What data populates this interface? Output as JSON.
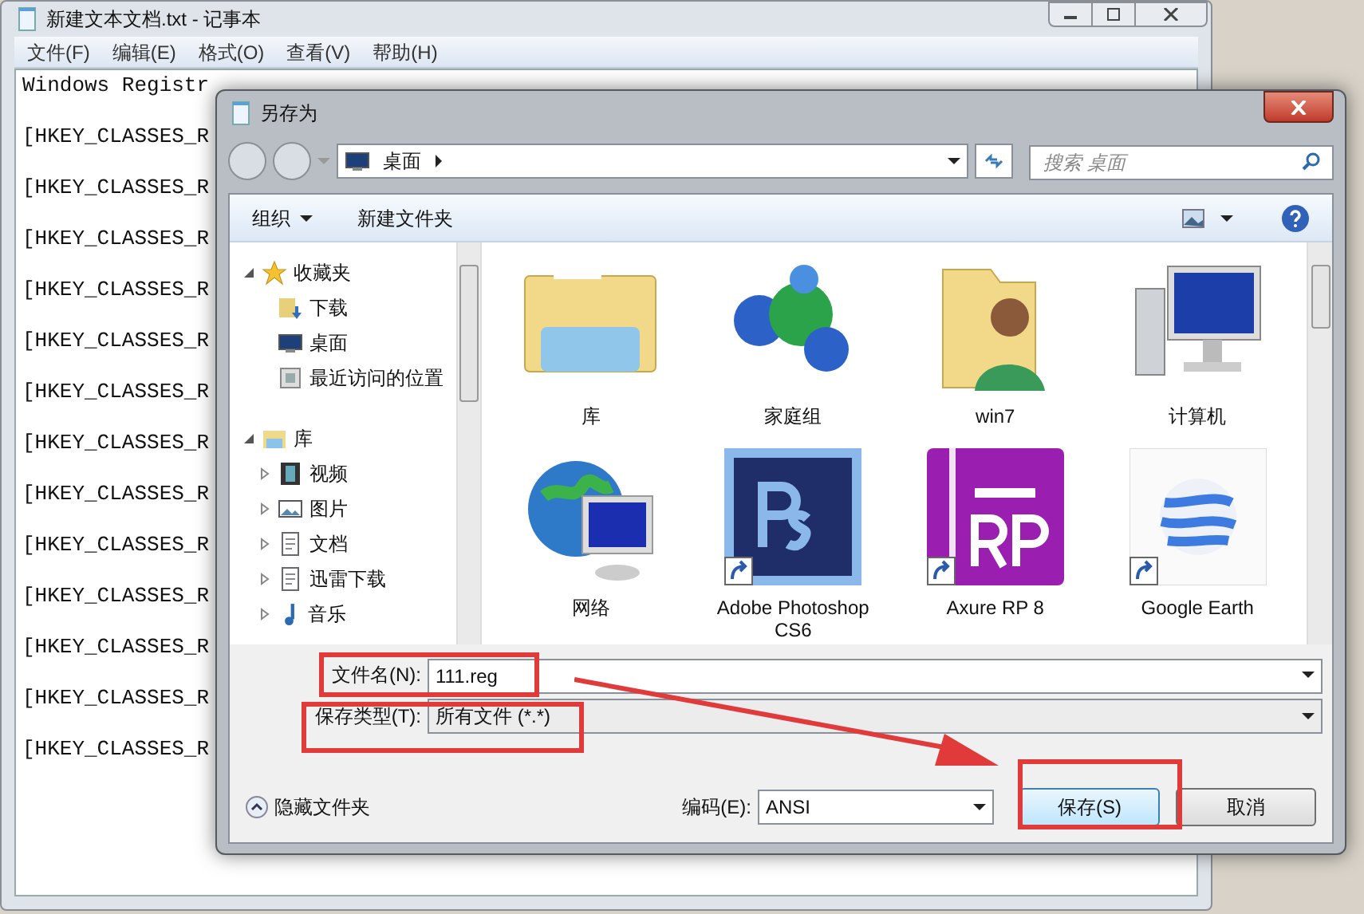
{
  "notepad": {
    "title": "新建文本文档.txt - 记事本",
    "menu": [
      "文件(F)",
      "编辑(E)",
      "格式(O)",
      "查看(V)",
      "帮助(H)"
    ],
    "lines": [
      "Windows Registr",
      "[HKEY_CLASSES_R",
      "[HKEY_CLASSES_R",
      "[HKEY_CLASSES_R",
      "[HKEY_CLASSES_R",
      "[HKEY_CLASSES_R",
      "[HKEY_CLASSES_R",
      "[HKEY_CLASSES_R",
      "[HKEY_CLASSES_R",
      "[HKEY_CLASSES_R",
      "[HKEY_CLASSES_R",
      "[HKEY_CLASSES_R",
      "[HKEY_CLASSES_R",
      "[HKEY_CLASSES_R"
    ]
  },
  "dialog": {
    "title": "另存为",
    "address": {
      "location": "桌面"
    },
    "search": {
      "placeholder": "搜索 桌面"
    },
    "toolbar": [
      {
        "label": "组织",
        "dropdown": true
      },
      {
        "label": "新建文件夹",
        "dropdown": false
      }
    ],
    "tree": [
      {
        "label": "收藏夹",
        "kind": "star",
        "expanded": true,
        "children": [
          {
            "label": "下载",
            "kind": "download"
          },
          {
            "label": "桌面",
            "kind": "desktop"
          },
          {
            "label": "最近访问的位置",
            "kind": "recent"
          }
        ]
      },
      {
        "label": "库",
        "kind": "library",
        "expanded": true,
        "children": [
          {
            "label": "视频",
            "kind": "video",
            "expanded": false
          },
          {
            "label": "图片",
            "kind": "picture",
            "expanded": false
          },
          {
            "label": "文档",
            "kind": "document",
            "expanded": false
          },
          {
            "label": "迅雷下载",
            "kind": "document",
            "expanded": false
          },
          {
            "label": "音乐",
            "kind": "music",
            "expanded": false
          }
        ]
      }
    ],
    "files": [
      {
        "name": "库",
        "kind": "library",
        "shortcut": false
      },
      {
        "name": "家庭组",
        "kind": "homegroup",
        "shortcut": false
      },
      {
        "name": "win7",
        "kind": "user",
        "shortcut": false
      },
      {
        "name": "计算机",
        "kind": "computer",
        "shortcut": false
      },
      {
        "name": "网络",
        "kind": "network",
        "shortcut": false
      },
      {
        "name": "Adobe Photoshop CS6",
        "kind": "photoshop",
        "shortcut": true
      },
      {
        "name": "Axure RP 8",
        "kind": "axure",
        "shortcut": true
      },
      {
        "name": "Google Earth",
        "kind": "earth",
        "shortcut": true
      }
    ],
    "filename": {
      "label": "文件名(N):",
      "value": "111.reg"
    },
    "filetype": {
      "label": "保存类型(T):",
      "value": "所有文件 (*.*)"
    },
    "hide_folders": "隐藏文件夹",
    "encoding": {
      "label": "编码(E):",
      "value": "ANSI"
    },
    "buttons": [
      {
        "label": "保存(S)",
        "kind": "primary"
      },
      {
        "label": "取消",
        "kind": "normal"
      }
    ]
  }
}
